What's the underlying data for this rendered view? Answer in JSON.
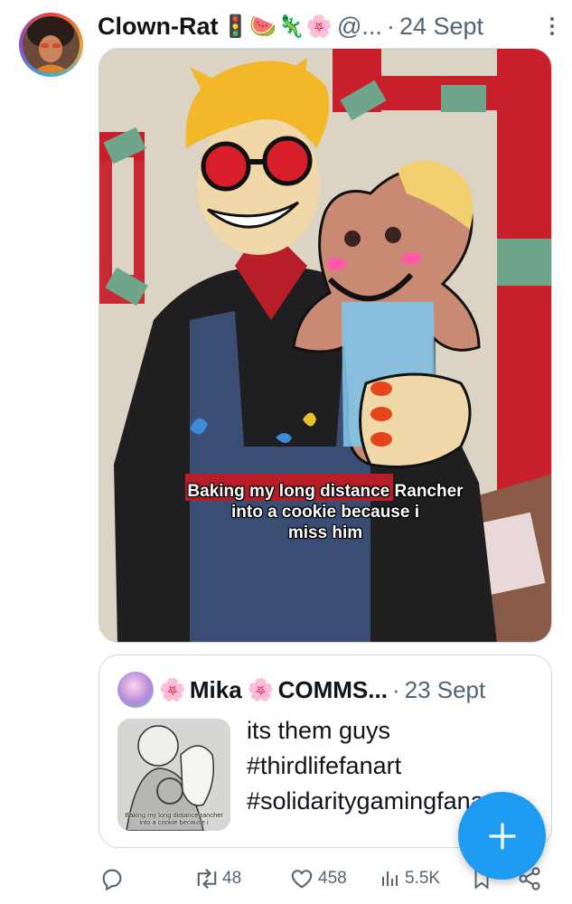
{
  "post": {
    "display_name": "Clown-Rat",
    "name_emojis": "🚦🍉🦎🌸",
    "handle": "@...",
    "separator": "·",
    "timestamp": "24 Sept",
    "media": {
      "caption_lines": [
        "Baking my long distance Rancher",
        "into a cookie because i",
        "miss him"
      ]
    }
  },
  "quote": {
    "emoji_before": "🌸",
    "display_name": "Mika",
    "emoji_after": "🌸",
    "name_suffix": "COMMS...",
    "separator": "·",
    "timestamp": "23 Sept",
    "text_lines": [
      "its them guys",
      "#thirdlifefanart",
      "#solidaritygamingfanart"
    ],
    "thumbnail_caption_lines": [
      "Baking my long distance rancher",
      "into a cookie because i"
    ]
  },
  "actions": {
    "reply_icon": "reply-icon",
    "repost_count": "48",
    "like_count": "458",
    "views_count": "5.5K",
    "bookmark_icon": "bookmark-icon",
    "share_icon": "share-icon"
  },
  "fab": {
    "icon": "plus-icon"
  },
  "colors": {
    "accent": "#1d9bf0",
    "secondary_text": "#536471",
    "border": "#cfd9de"
  }
}
